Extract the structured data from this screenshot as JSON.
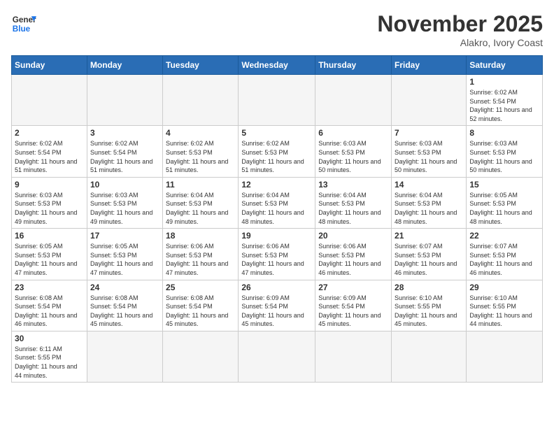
{
  "header": {
    "logo_general": "General",
    "logo_blue": "Blue",
    "month_title": "November 2025",
    "subtitle": "Alakro, Ivory Coast"
  },
  "days_of_week": [
    "Sunday",
    "Monday",
    "Tuesday",
    "Wednesday",
    "Thursday",
    "Friday",
    "Saturday"
  ],
  "weeks": [
    [
      {
        "day": "",
        "info": ""
      },
      {
        "day": "",
        "info": ""
      },
      {
        "day": "",
        "info": ""
      },
      {
        "day": "",
        "info": ""
      },
      {
        "day": "",
        "info": ""
      },
      {
        "day": "",
        "info": ""
      },
      {
        "day": "1",
        "info": "Sunrise: 6:02 AM\nSunset: 5:54 PM\nDaylight: 11 hours and 52 minutes."
      }
    ],
    [
      {
        "day": "2",
        "info": "Sunrise: 6:02 AM\nSunset: 5:54 PM\nDaylight: 11 hours and 51 minutes."
      },
      {
        "day": "3",
        "info": "Sunrise: 6:02 AM\nSunset: 5:54 PM\nDaylight: 11 hours and 51 minutes."
      },
      {
        "day": "4",
        "info": "Sunrise: 6:02 AM\nSunset: 5:53 PM\nDaylight: 11 hours and 51 minutes."
      },
      {
        "day": "5",
        "info": "Sunrise: 6:02 AM\nSunset: 5:53 PM\nDaylight: 11 hours and 51 minutes."
      },
      {
        "day": "6",
        "info": "Sunrise: 6:03 AM\nSunset: 5:53 PM\nDaylight: 11 hours and 50 minutes."
      },
      {
        "day": "7",
        "info": "Sunrise: 6:03 AM\nSunset: 5:53 PM\nDaylight: 11 hours and 50 minutes."
      },
      {
        "day": "8",
        "info": "Sunrise: 6:03 AM\nSunset: 5:53 PM\nDaylight: 11 hours and 50 minutes."
      }
    ],
    [
      {
        "day": "9",
        "info": "Sunrise: 6:03 AM\nSunset: 5:53 PM\nDaylight: 11 hours and 49 minutes."
      },
      {
        "day": "10",
        "info": "Sunrise: 6:03 AM\nSunset: 5:53 PM\nDaylight: 11 hours and 49 minutes."
      },
      {
        "day": "11",
        "info": "Sunrise: 6:04 AM\nSunset: 5:53 PM\nDaylight: 11 hours and 49 minutes."
      },
      {
        "day": "12",
        "info": "Sunrise: 6:04 AM\nSunset: 5:53 PM\nDaylight: 11 hours and 48 minutes."
      },
      {
        "day": "13",
        "info": "Sunrise: 6:04 AM\nSunset: 5:53 PM\nDaylight: 11 hours and 48 minutes."
      },
      {
        "day": "14",
        "info": "Sunrise: 6:04 AM\nSunset: 5:53 PM\nDaylight: 11 hours and 48 minutes."
      },
      {
        "day": "15",
        "info": "Sunrise: 6:05 AM\nSunset: 5:53 PM\nDaylight: 11 hours and 48 minutes."
      }
    ],
    [
      {
        "day": "16",
        "info": "Sunrise: 6:05 AM\nSunset: 5:53 PM\nDaylight: 11 hours and 47 minutes."
      },
      {
        "day": "17",
        "info": "Sunrise: 6:05 AM\nSunset: 5:53 PM\nDaylight: 11 hours and 47 minutes."
      },
      {
        "day": "18",
        "info": "Sunrise: 6:06 AM\nSunset: 5:53 PM\nDaylight: 11 hours and 47 minutes."
      },
      {
        "day": "19",
        "info": "Sunrise: 6:06 AM\nSunset: 5:53 PM\nDaylight: 11 hours and 47 minutes."
      },
      {
        "day": "20",
        "info": "Sunrise: 6:06 AM\nSunset: 5:53 PM\nDaylight: 11 hours and 46 minutes."
      },
      {
        "day": "21",
        "info": "Sunrise: 6:07 AM\nSunset: 5:53 PM\nDaylight: 11 hours and 46 minutes."
      },
      {
        "day": "22",
        "info": "Sunrise: 6:07 AM\nSunset: 5:53 PM\nDaylight: 11 hours and 46 minutes."
      }
    ],
    [
      {
        "day": "23",
        "info": "Sunrise: 6:08 AM\nSunset: 5:54 PM\nDaylight: 11 hours and 46 minutes."
      },
      {
        "day": "24",
        "info": "Sunrise: 6:08 AM\nSunset: 5:54 PM\nDaylight: 11 hours and 45 minutes."
      },
      {
        "day": "25",
        "info": "Sunrise: 6:08 AM\nSunset: 5:54 PM\nDaylight: 11 hours and 45 minutes."
      },
      {
        "day": "26",
        "info": "Sunrise: 6:09 AM\nSunset: 5:54 PM\nDaylight: 11 hours and 45 minutes."
      },
      {
        "day": "27",
        "info": "Sunrise: 6:09 AM\nSunset: 5:54 PM\nDaylight: 11 hours and 45 minutes."
      },
      {
        "day": "28",
        "info": "Sunrise: 6:10 AM\nSunset: 5:55 PM\nDaylight: 11 hours and 45 minutes."
      },
      {
        "day": "29",
        "info": "Sunrise: 6:10 AM\nSunset: 5:55 PM\nDaylight: 11 hours and 44 minutes."
      }
    ],
    [
      {
        "day": "30",
        "info": "Sunrise: 6:11 AM\nSunset: 5:55 PM\nDaylight: 11 hours and 44 minutes."
      },
      {
        "day": "",
        "info": ""
      },
      {
        "day": "",
        "info": ""
      },
      {
        "day": "",
        "info": ""
      },
      {
        "day": "",
        "info": ""
      },
      {
        "day": "",
        "info": ""
      },
      {
        "day": "",
        "info": ""
      }
    ]
  ]
}
